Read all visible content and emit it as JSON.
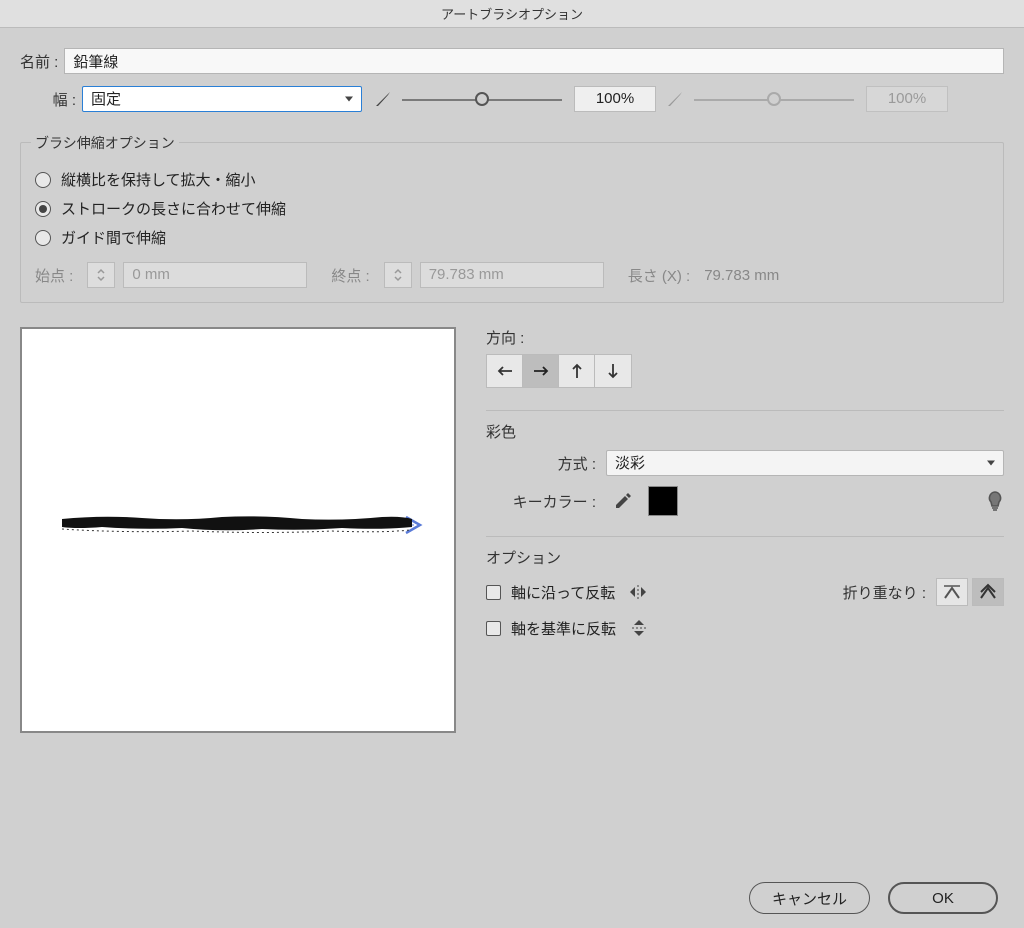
{
  "window": {
    "title": "アートブラシオプション"
  },
  "name_field": {
    "label": "名前 :",
    "value": "鉛筆線"
  },
  "width_row": {
    "label": "幅 :",
    "select_value": "固定",
    "slider1_pct": "100%",
    "slider2_pct": "100%"
  },
  "scale_group": {
    "title": "ブラシ伸縮オプション",
    "opt_proportional": "縦横比を保持して拡大・縮小",
    "opt_stretch": "ストロークの長さに合わせて伸縮",
    "opt_guides": "ガイド間で伸縮",
    "start_label": "始点 :",
    "start_value": "0 mm",
    "end_label": "終点 :",
    "end_value": "79.783 mm",
    "length_label": "長さ (X) :",
    "length_value": "79.783 mm"
  },
  "direction": {
    "label": "方向 :"
  },
  "colorization": {
    "title": "彩色",
    "method_label": "方式 :",
    "method_value": "淡彩",
    "keycolor_label": "キーカラー :"
  },
  "options": {
    "title": "オプション",
    "flip_along": "軸に沿って反転",
    "flip_across": "軸を基準に反転",
    "overlap_label": "折り重なり :"
  },
  "buttons": {
    "cancel": "キャンセル",
    "ok": "OK"
  }
}
